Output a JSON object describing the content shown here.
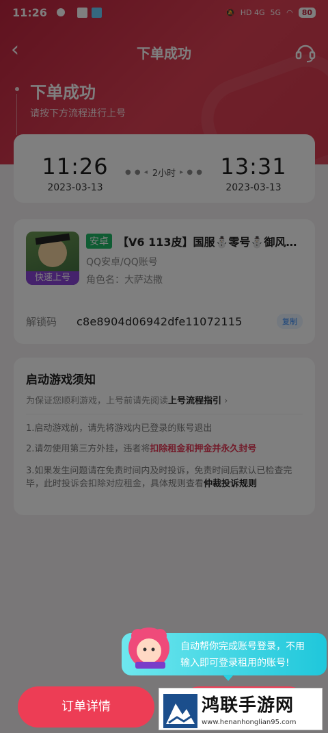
{
  "status": {
    "time": "11:26",
    "signal_left": "HD 4G",
    "signal_right": "5G",
    "battery": "80"
  },
  "nav": {
    "title": "下单成功"
  },
  "success": {
    "heading": "下单成功",
    "subtitle": "请按下方流程进行上号"
  },
  "rental": {
    "start_time": "11:26",
    "start_date": "2023-03-13",
    "duration": "2小时",
    "end_time": "13:31",
    "end_date": "2023-03-13"
  },
  "account": {
    "badge": "快速上号",
    "platform_tag": "安卓",
    "name": "【V6 113皮】国服⛄零号⛄御风…",
    "type": "QQ安卓/QQ账号",
    "role": "角色名：大萨达撒",
    "unlock_label": "解锁码",
    "unlock_code": "c8e8904d06942dfe11072115",
    "copy_label": "复制"
  },
  "notice": {
    "title": "启动游戏须知",
    "subtitle_prefix": "为保证您顺利游戏，上号前请先阅读",
    "subtitle_link": "上号流程指引",
    "item1": "1.启动游戏前，请先将游戏内已登录的账号退出",
    "item2_prefix": "2.请勿使用第三方外挂，违者将",
    "item2_red": "扣除租金和押金并永久封号",
    "item3_prefix": "3.如果发生问题请在免责时间内及时投诉，免责时间后默认已检查完毕，此时投诉会扣除对应租金，具体规则查看",
    "item3_link": "仲裁投诉规则"
  },
  "bottom": {
    "detail_button": "订单详情"
  },
  "bubble": {
    "line1": "自动帮你完成账号登录，不用",
    "line2": "输入即可登录租用的账号!"
  },
  "watermark": {
    "title": "鸿联手游网",
    "url": "www.henanhonglian95.com"
  },
  "colors": {
    "brand": "#e04155",
    "android_tag": "#1fb866",
    "badge": "#8a44d9",
    "warning": "#e53754",
    "bubble": "#1fc7db"
  }
}
